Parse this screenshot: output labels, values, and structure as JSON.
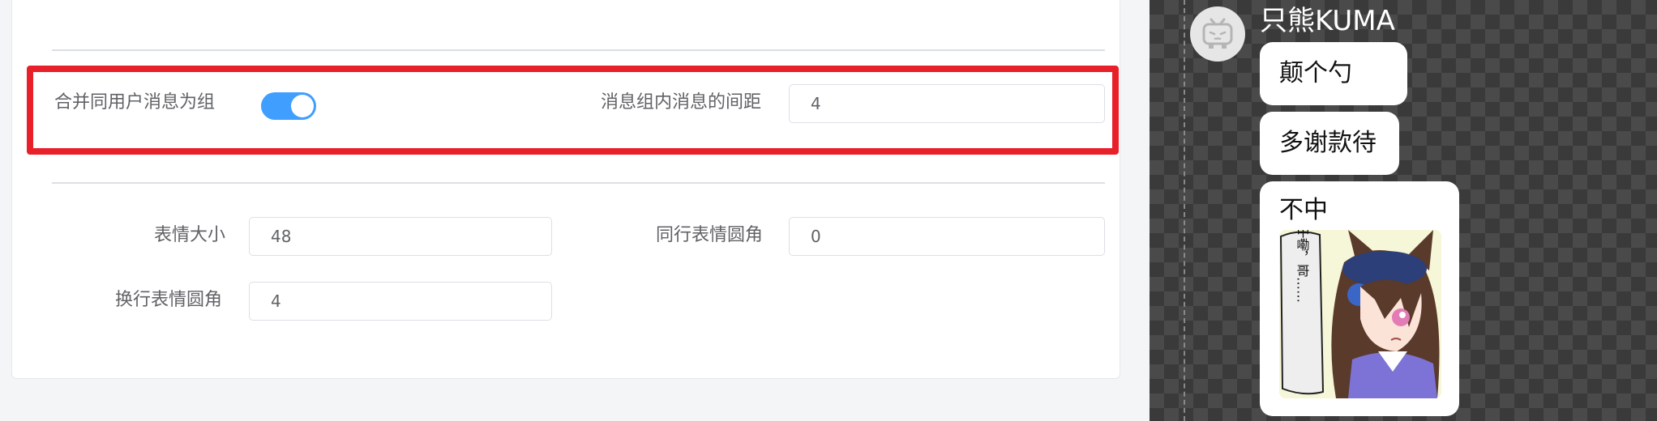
{
  "settings": {
    "merge_group": {
      "label": "合并同用户消息为组",
      "enabled": true
    },
    "group_spacing": {
      "label": "消息组内消息的间距",
      "value": "4"
    },
    "emote_size": {
      "label": "表情大小",
      "value": "48"
    },
    "inline_emote_radius": {
      "label": "同行表情圆角",
      "value": "0"
    },
    "wrap_emote_radius": {
      "label": "换行表情圆角",
      "value": "4"
    },
    "toggle_on_color": "#409eff",
    "highlight_color": "#e8202a"
  },
  "preview": {
    "username": "只熊KUMA",
    "messages": [
      "颠个勺",
      "多谢款待",
      "不中"
    ],
    "sticker": {
      "caption": "不中嘞，哥……"
    }
  }
}
